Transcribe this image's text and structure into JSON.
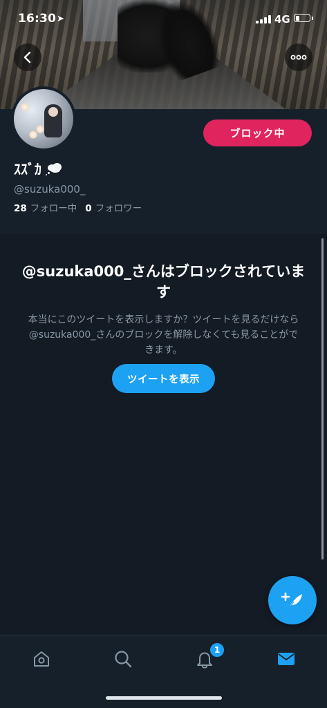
{
  "status_bar": {
    "time": "16:30",
    "location_glyph": "➤",
    "network": "4G",
    "battery_level": 0.25
  },
  "header": {
    "back_icon": "chevron-left-icon",
    "more_icon": "more-horizontal-icon"
  },
  "profile": {
    "display_name": "ｽｽﾞｶ",
    "handle": "@suzuka000_",
    "following_count": "28",
    "following_label": "フォロー中",
    "followers_count": "0",
    "followers_label": "フォロワー",
    "block_button_label": "ブロック中",
    "block_button_color": "#e0245e"
  },
  "blocked_notice": {
    "title": "@suzuka000_さんはブロックされています",
    "description": "本当にこのツイートを表示しますか？ツイートを見るだけなら@suzuka000_さんのブロックを解除しなくても見ることができます。",
    "button_label": "ツイートを表示",
    "button_color": "#1da1f2"
  },
  "fab": {
    "icon": "compose-tweet-icon"
  },
  "tab_bar": {
    "tabs": [
      {
        "name": "home",
        "icon": "home-icon",
        "active": false
      },
      {
        "name": "search",
        "icon": "search-icon",
        "active": false
      },
      {
        "name": "notifications",
        "icon": "bell-icon",
        "active": false,
        "badge": "1"
      },
      {
        "name": "messages",
        "icon": "envelope-icon",
        "active": true
      }
    ],
    "active_color": "#1da1f2",
    "inactive_color": "#8899a6"
  }
}
